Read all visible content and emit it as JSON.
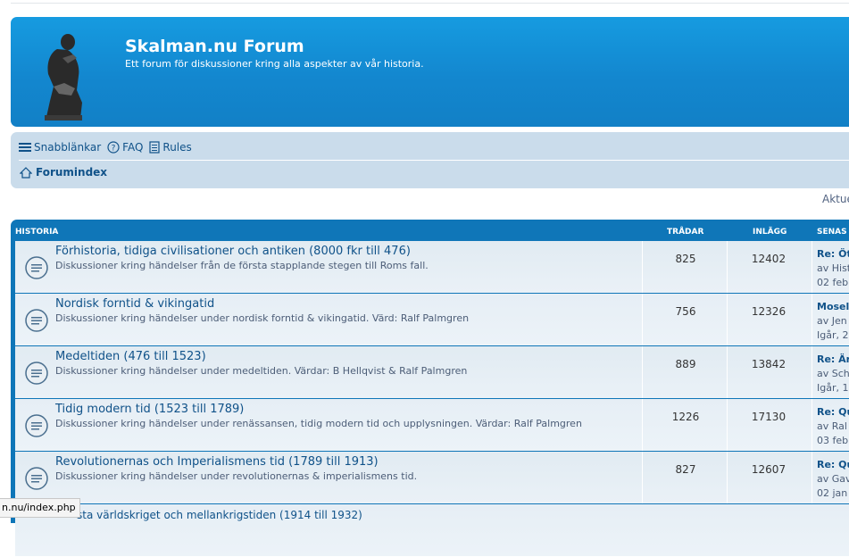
{
  "header": {
    "title": "Skalman.nu Forum",
    "description": "Ett forum för diskussioner kring alla aspekter av vår historia."
  },
  "nav": {
    "quicklinks": "Snabblänkar",
    "faq": "FAQ",
    "rules": "Rules",
    "breadcrumb": "Forumindex"
  },
  "aside": {
    "aktue": "Aktue"
  },
  "category": {
    "name": "HISTORIA",
    "col_topics": "TRÅDAR",
    "col_posts": "INLÄGG",
    "col_last": "SENAS"
  },
  "forums": [
    {
      "title": "Förhistoria, tidiga civilisationer och antiken (8000 fkr till 476)",
      "desc": "Diskussioner kring händelser från de första stapplande stegen till Roms fall.",
      "topics": "825",
      "posts": "12402",
      "last_title": "Re: Öt",
      "last_by": "av Hist",
      "last_time": "02 feb"
    },
    {
      "title": "Nordisk forntid & vikingatid",
      "desc": "Diskussioner kring händelser under nordisk forntid & vikingatid. Värd: Ralf Palmgren",
      "topics": "756",
      "posts": "12326",
      "last_title": "Mosel",
      "last_by": "av Jen",
      "last_time": "Igår, 2"
    },
    {
      "title": "Medeltiden (476 till 1523)",
      "desc": "Diskussioner kring händelser under medeltiden. Värdar: B Hellqvist & Ralf Palmgren",
      "topics": "889",
      "posts": "13842",
      "last_title": "Re: Är",
      "last_by": "av Sch",
      "last_time": "Igår, 1"
    },
    {
      "title": "Tidig modern tid (1523 till 1789)",
      "desc": "Diskussioner kring händelser under renässansen, tidig modern tid och upplysningen. Värdar: Ralf Palmgren",
      "topics": "1226",
      "posts": "17130",
      "last_title": "Re: Qu",
      "last_by": "av Ral",
      "last_time": "03 feb"
    },
    {
      "title": "Revolutionernas och Imperialismens tid (1789 till 1913)",
      "desc": "Diskussioner kring händelser under revolutionernas & imperialismens tid.",
      "topics": "827",
      "posts": "12607",
      "last_title": "Re: Qu",
      "last_by": "av Gav",
      "last_time": "02 jan"
    }
  ],
  "peek_title": "sta världskriget och mellankrigstiden (1914 till 1932)",
  "statusbar": "n.nu/index.php"
}
